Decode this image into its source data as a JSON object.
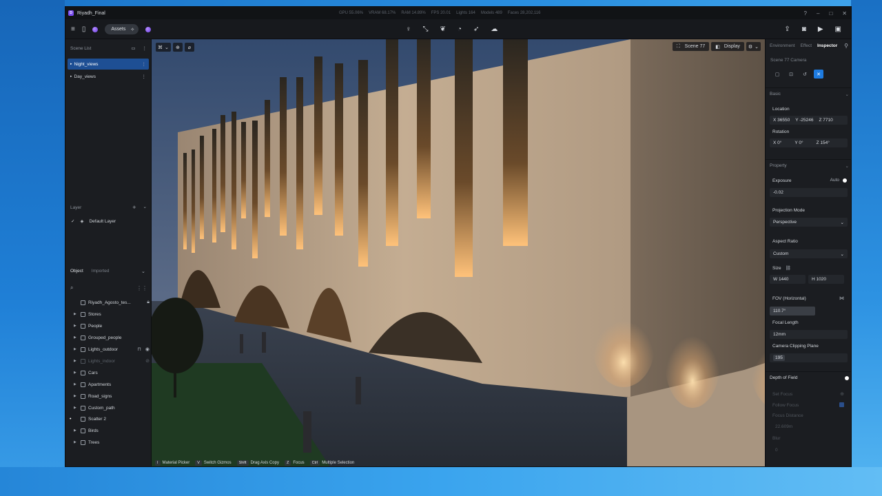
{
  "app": {
    "title": "Riyadh_Final"
  },
  "stats": [
    "GPU 55.06%",
    "VRAM 68.17%",
    "RAM 14.89%",
    "FPS 20.01",
    "Lights 164",
    "Models 489",
    "Faces 28,202,116"
  ],
  "toolbar": {
    "assets_label": "Assets"
  },
  "scene_list": {
    "title": "Scene List",
    "items": [
      {
        "label": "Night_views",
        "active": true
      },
      {
        "label": "Day_views",
        "active": false
      }
    ]
  },
  "layer": {
    "title": "Layer",
    "default_layer": "Default Layer"
  },
  "object_panel": {
    "tab_object": "Object",
    "tab_imported": "Imported",
    "tree": [
      {
        "label": "Riyadh_Agosto_tes..."
      },
      {
        "label": "Stores"
      },
      {
        "label": "People"
      },
      {
        "label": "Grouped_people"
      },
      {
        "label": "Lights_outdoor"
      },
      {
        "label": "Lights_indoor"
      },
      {
        "label": "Cars"
      },
      {
        "label": "Apartments"
      },
      {
        "label": "Road_signs"
      },
      {
        "label": "Custom_path"
      },
      {
        "label": "Scatter 2"
      },
      {
        "label": "Birds"
      },
      {
        "label": "Trees"
      }
    ]
  },
  "viewport": {
    "scene_label": "Scene 77",
    "display_label": "Display",
    "shortcuts": [
      {
        "key": "I",
        "label": "Material Picker"
      },
      {
        "key": "V",
        "label": "Switch Gizmos"
      },
      {
        "key": "Shift",
        "label": "Drag Axis Copy"
      },
      {
        "key": "Z",
        "label": "Focus"
      },
      {
        "key": "Ctrl",
        "label": "Multiple Selection"
      }
    ]
  },
  "inspector": {
    "tabs": [
      "Environment",
      "Effect",
      "Inspector"
    ],
    "camera_title": "Scene 77 Camera",
    "basic": "Basic",
    "location_label": "Location",
    "location": {
      "x": "X 36550",
      "y": "Y -25246",
      "z": "Z 7710"
    },
    "rotation_label": "Rotation",
    "rotation": {
      "x": "X 0°",
      "y": "Y 0°",
      "z": "Z 154°"
    },
    "property": "Property",
    "exposure_label": "Exposure",
    "exposure_auto": "Auto",
    "exposure_value": "-0.02",
    "projection_label": "Projection Mode",
    "projection_value": "Perspective",
    "aspect_label": "Aspect Ratio",
    "aspect_value": "Custom",
    "size_label": "Size",
    "size_w": "W 1440",
    "size_h": "H 1020",
    "fov_label": "FOV (Horizontal)",
    "fov_value": "110.7°",
    "focal_label": "Focal Length",
    "focal_value": "12mm",
    "clip_label": "Camera Clipping Plane",
    "clip_value": "195",
    "dof_label": "Depth of Field",
    "set_focus": "Set Focus",
    "follow_focus": "Follow Focus",
    "focus_distance_label": "Focus Distance",
    "focus_distance_value": "22.609m",
    "blur_label": "Blur",
    "blur_value": "0"
  }
}
